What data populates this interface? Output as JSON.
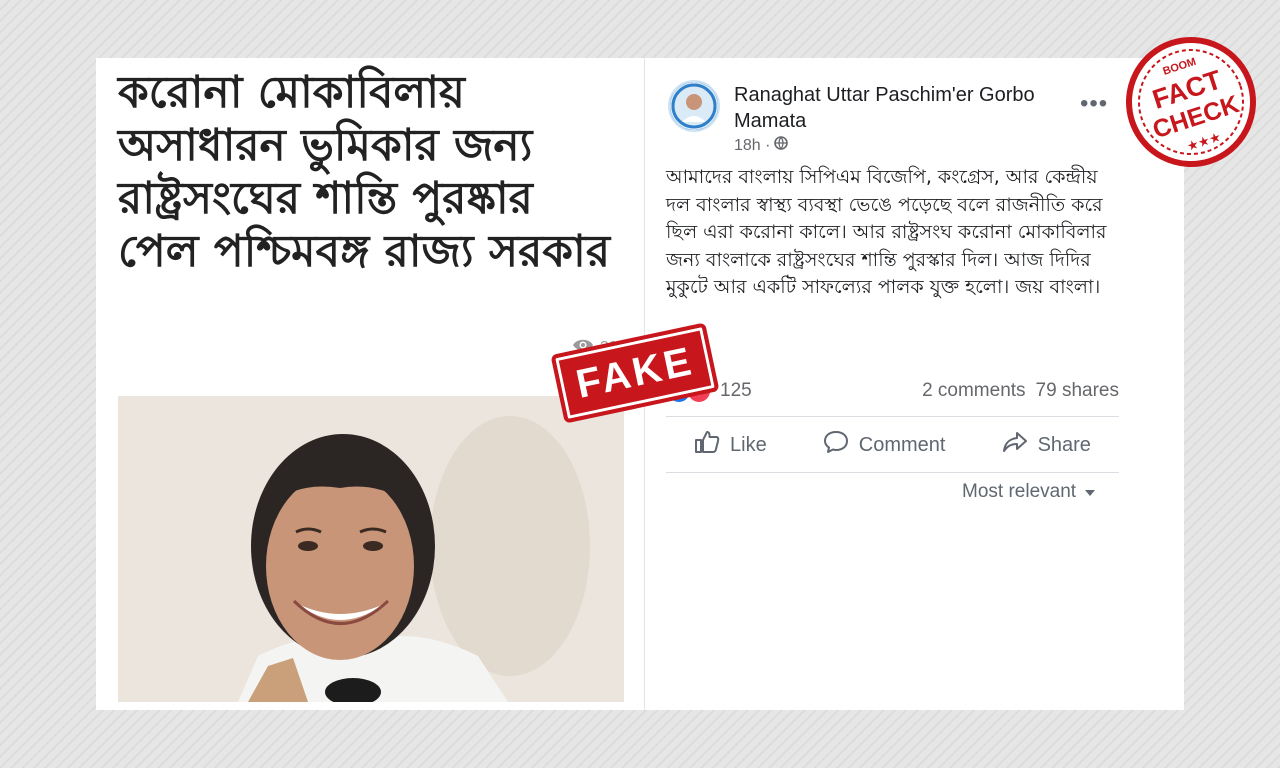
{
  "headline": "করোনা মোকাবিলায় অসাধারন ভুমিকার জন্য রাষ্ট্রসংঘের শান্তি পুরষ্কার পেল পশ্চিমবঙ্গ রাজ্য সরকার",
  "views": "39",
  "fake_label": "FAKE",
  "post": {
    "page_name": "Ranaghat Uttar Paschim'er Gorbo Mamata",
    "time": "18h ·",
    "text": "আমাদের বাংলায় সিপিএম বিজেপি, কংগ্রেস, আর কেন্দ্রীয় দল বাংলার স্বাস্থ্য ব্যবস্থা ভেঙে পড়েছে বলে রাজনীতি করে ছিল এরা করোনা কালে। আর রাষ্ট্রসংঘ করোনা মোকাবিলার জন্য বাংলাকে রাষ্ট্রসংঘের শান্তি পুরস্কার দিল। আজ দিদির মুকুটে আর একটি সাফল্যের পালক যুক্ত হলো। জয় বাংলা।",
    "reactions_count": "125",
    "comments": "2 comments",
    "shares": "79 shares",
    "actions": {
      "like": "Like",
      "comment": "Comment",
      "share": "Share"
    },
    "sort": "Most relevant"
  },
  "seal": {
    "top": "BOOM",
    "line1": "FACT",
    "line2": "CHECK",
    "stars": "★★★"
  },
  "colors": {
    "stamp_red": "#c8161d",
    "like_blue": "#1877f2",
    "love_red": "#f33e58"
  },
  "icons": [
    "eye-icon",
    "globe-icon",
    "more-icon",
    "like-reaction-icon",
    "love-reaction-icon",
    "thumbs-up-icon",
    "comment-icon",
    "share-icon",
    "caret-down-icon"
  ]
}
